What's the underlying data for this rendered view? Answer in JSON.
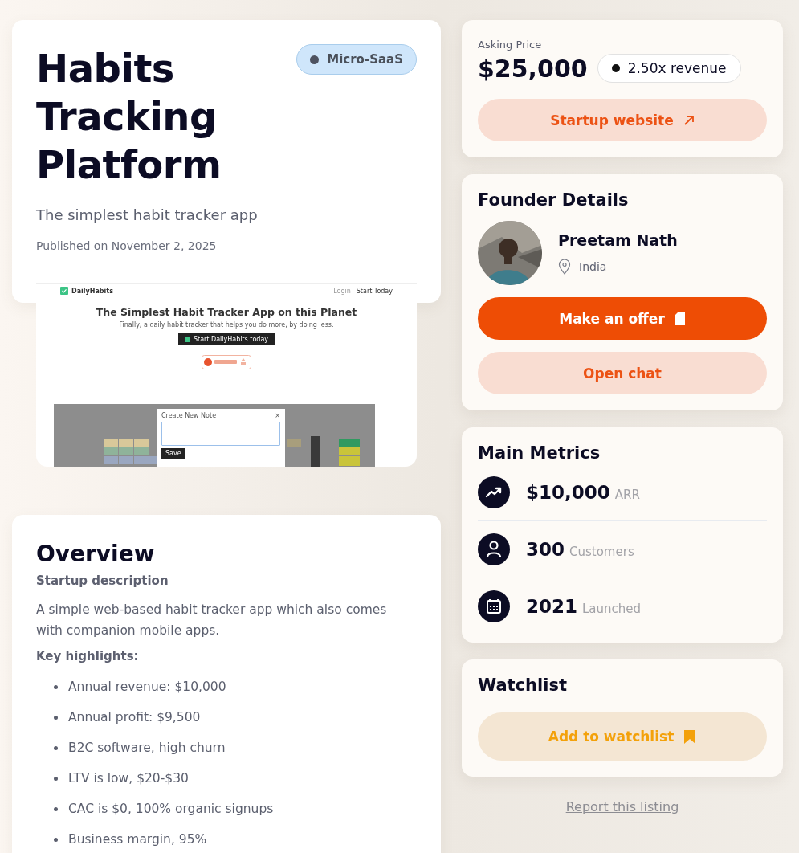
{
  "listing": {
    "title": "Habits Tracking Platform",
    "category": "Micro-SaaS",
    "tagline": "The simplest habit tracker app",
    "published_label": "Published on",
    "published_date": "November 2, 2025"
  },
  "preview": {
    "brand": "DailyHabits",
    "links": [
      "Login",
      "Start Today"
    ],
    "headline": "The Simplest Habit Tracker App on this Planet",
    "subline": "Finally, a daily habit tracker that helps you do more, by doing less.",
    "cta": "Start DailyHabits today",
    "dialog": {
      "title": "Create New Note",
      "close": "×",
      "button": "Save"
    }
  },
  "overview": {
    "title": "Overview",
    "description_heading": "Startup description",
    "description": "A simple web-based habit tracker app which also comes with companion mobile apps.",
    "highlights_heading": "Key highlights:",
    "highlights": [
      "Annual revenue: $10,000",
      "Annual profit: $9,500",
      "B2C software, high churn",
      "LTV is low, $20-$30",
      "CAC is $0, 100% organic signups",
      "Business margin, 95%"
    ]
  },
  "pricing": {
    "label": "Asking Price",
    "price": "$25,000",
    "multiple": "2.50x revenue",
    "website_button": "Startup website"
  },
  "founder": {
    "title": "Founder Details",
    "name": "Preetam Nath",
    "location": "India",
    "offer_button": "Make an offer",
    "chat_button": "Open chat"
  },
  "metrics": {
    "title": "Main Metrics",
    "items": [
      {
        "kind": "trend",
        "value": "$10,000",
        "label": "ARR"
      },
      {
        "kind": "user",
        "value": "300",
        "label": "Customers"
      },
      {
        "kind": "calendar",
        "value": "2021",
        "label": "Launched"
      }
    ]
  },
  "watchlist": {
    "title": "Watchlist",
    "button": "Add to watchlist"
  },
  "report_link": "Report this listing"
}
